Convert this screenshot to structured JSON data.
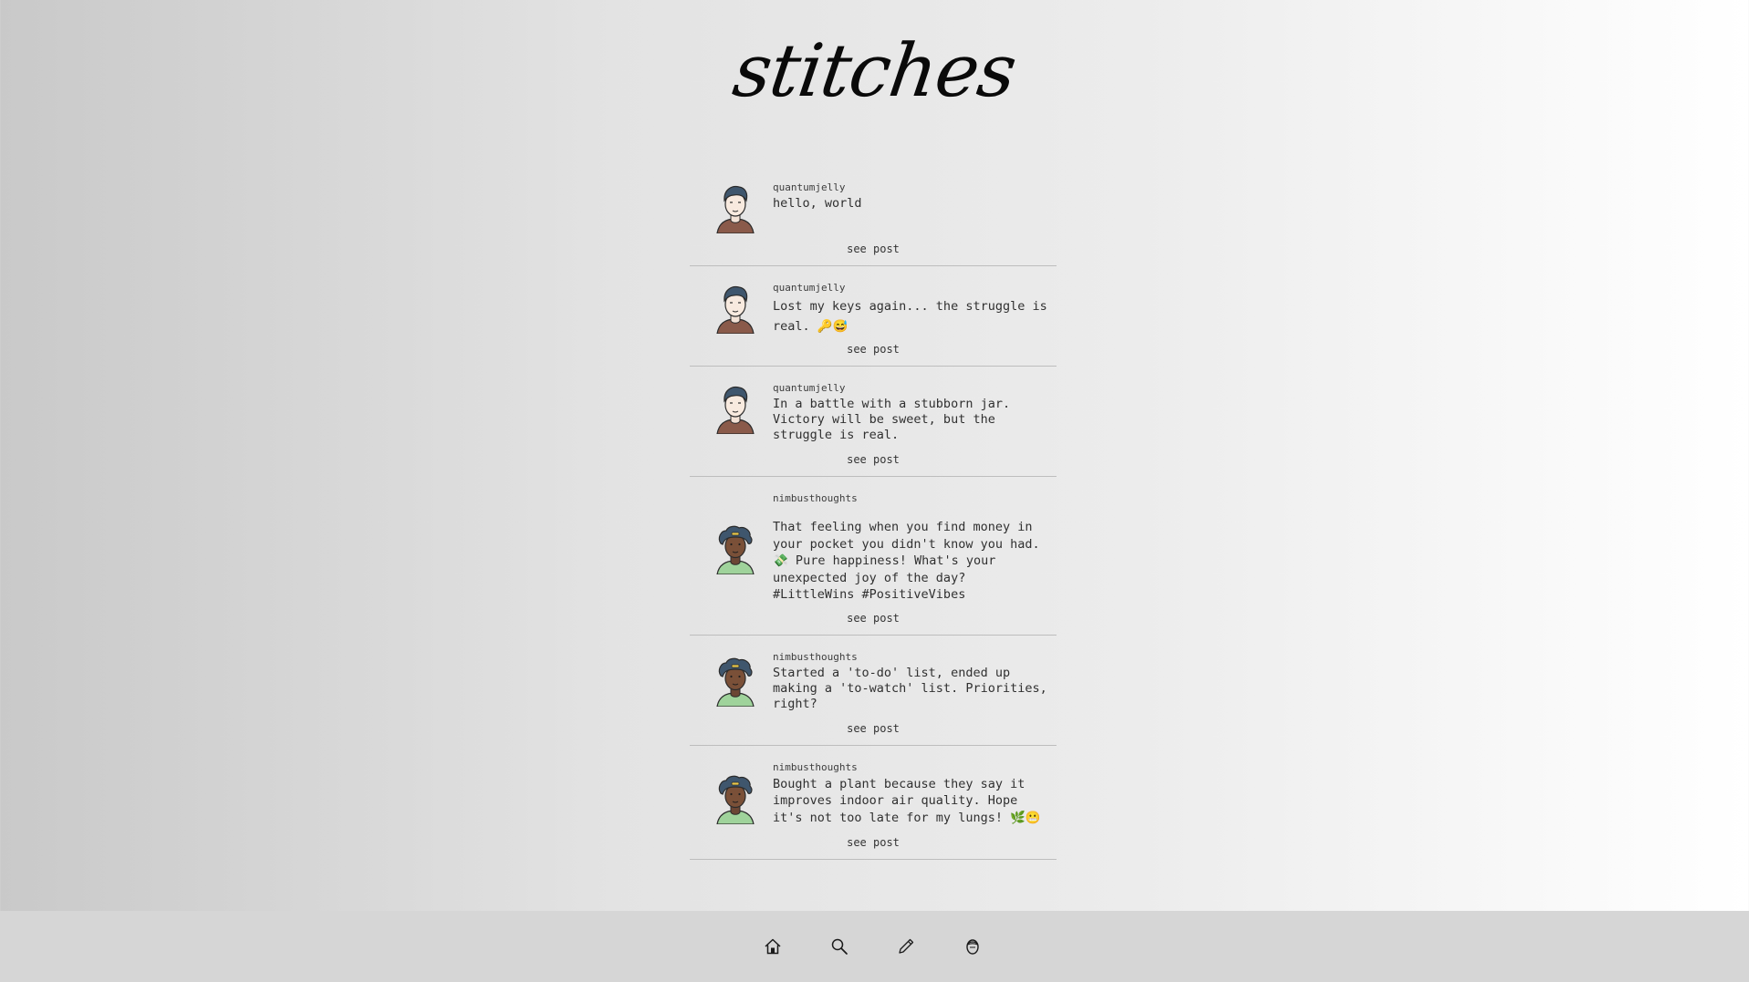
{
  "app": {
    "logo": "stitches"
  },
  "posts": [
    {
      "username": "quantumjelly",
      "text": "hello, world",
      "link": "see post",
      "avatar": "male-avatar-icon"
    },
    {
      "username": "quantumjelly",
      "text": "Lost my keys again... the struggle is real. 🔑😅",
      "link": "see post",
      "avatar": "male-avatar-icon"
    },
    {
      "username": "quantumjelly",
      "text": "In a battle with a stubborn jar. Victory will be sweet, but the struggle is real.",
      "link": "see post",
      "avatar": "male-avatar-icon"
    },
    {
      "username": "nimbusthoughts",
      "text": "That feeling when you find money in your pocket you didn't know you had. 💸 Pure happiness! What's your unexpected joy of the day? #LittleWins #PositiveVibes",
      "link": "see post",
      "avatar": "curly-hair-avatar-icon"
    },
    {
      "username": "nimbusthoughts",
      "text": "Started a 'to-do' list, ended up making a 'to-watch' list. Priorities, right?",
      "link": "see post",
      "avatar": "curly-hair-avatar-icon"
    },
    {
      "username": "nimbusthoughts",
      "text": "Bought a plant because they say it improves indoor air quality. Hope it's not too late for my lungs! 🌿😬",
      "link": "see post",
      "avatar": "curly-hair-avatar-icon"
    }
  ],
  "nav": {
    "items": [
      {
        "name": "home",
        "icon": "home-icon"
      },
      {
        "name": "search",
        "icon": "search-icon"
      },
      {
        "name": "compose",
        "icon": "pencil-icon"
      },
      {
        "name": "profile",
        "icon": "profile-icon"
      }
    ]
  },
  "colors": {
    "background_left": "#c9c9c9",
    "background_right": "#ffffff",
    "navbar": "#d6d6d6",
    "divider": "#bdbdbd"
  }
}
